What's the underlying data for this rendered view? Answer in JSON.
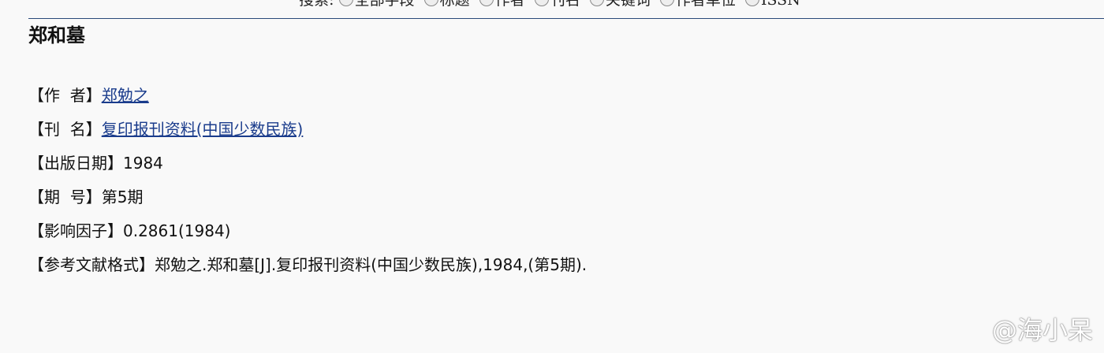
{
  "search": {
    "label": "搜索:",
    "options": [
      "全部字段",
      "标题",
      "作者",
      "刊名",
      "关键词",
      "作者单位",
      "ISSN"
    ]
  },
  "article": {
    "title": "郑和墓",
    "author_label": "【作  者】",
    "author": "郑勉之",
    "journal_label": "【刊  名】",
    "journal": "复印报刊资料(中国少数民族)",
    "date_label": "【出版日期】",
    "date": "1984",
    "issue_label": "【期  号】",
    "issue": "第5期",
    "impact_label": "【影响因子】",
    "impact": "0.2861(1984)",
    "citation_label": "【参考文献格式】",
    "citation": "郑勉之.郑和墓[J].复印报刊资料(中国少数民族),1984,(第5期)."
  },
  "watermark": "@海小呆"
}
